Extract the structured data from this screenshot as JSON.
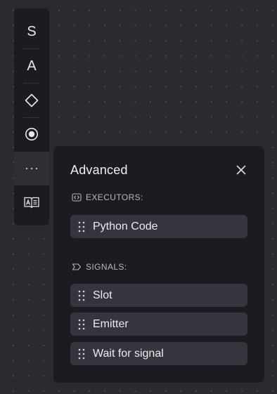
{
  "toolbar": {
    "tools": [
      {
        "id": "s",
        "label": "S"
      },
      {
        "id": "a",
        "label": "A"
      },
      {
        "id": "diamond",
        "icon": "diamond-icon"
      },
      {
        "id": "radio",
        "icon": "radio-target-icon"
      },
      {
        "id": "more",
        "icon": "ellipsis-icon",
        "active": true
      },
      {
        "id": "translate",
        "icon": "translate-book-icon"
      }
    ]
  },
  "panel": {
    "title": "Advanced",
    "close_icon": "close-icon",
    "sections": [
      {
        "label": "EXECUTORS:",
        "icon": "code-brackets-icon",
        "items": [
          {
            "label": "Python Code"
          }
        ]
      },
      {
        "label": "SIGNALS:",
        "icon": "signal-tag-icon",
        "items": [
          {
            "label": "Slot"
          },
          {
            "label": "Emitter"
          },
          {
            "label": "Wait for signal"
          }
        ]
      }
    ]
  },
  "colors": {
    "canvas": "#2a2a2f",
    "panel": "#1b1c21",
    "item": "#34353d",
    "text": "#ececf0"
  }
}
